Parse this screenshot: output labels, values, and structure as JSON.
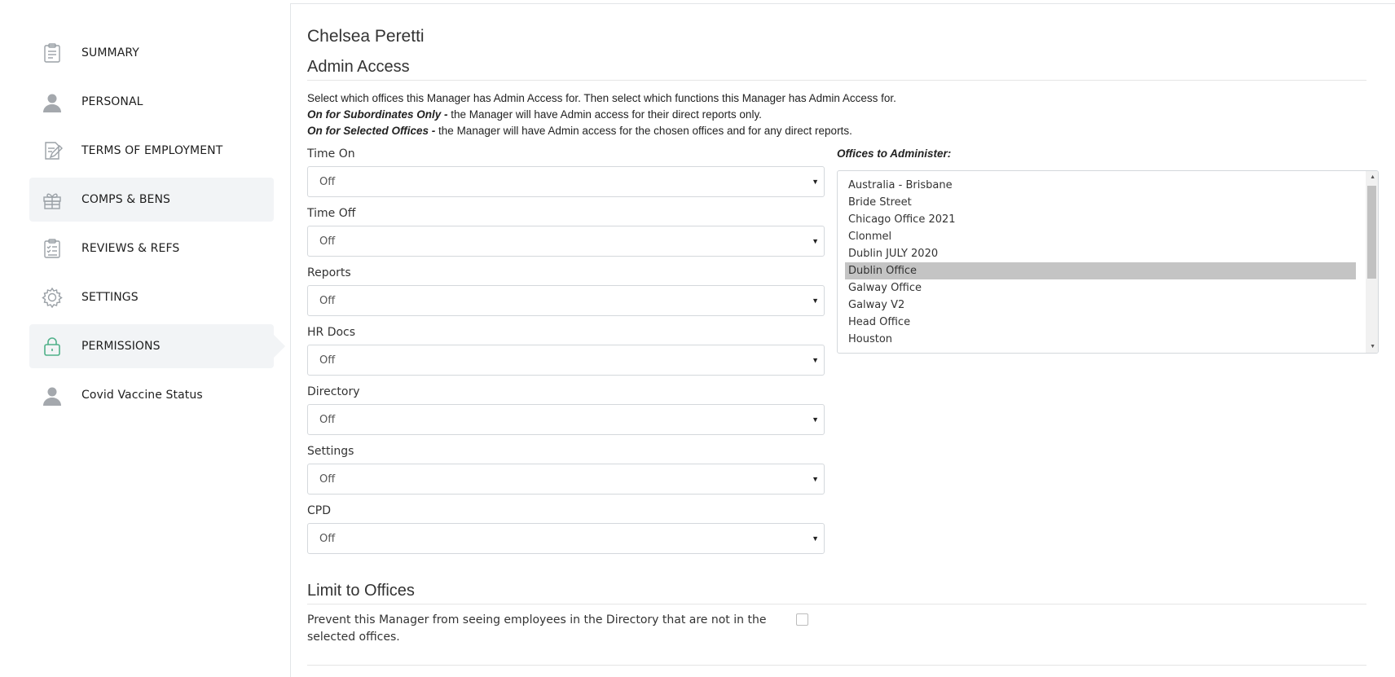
{
  "sidebar": {
    "items": [
      {
        "label": "SUMMARY",
        "icon": "summary-icon"
      },
      {
        "label": "PERSONAL",
        "icon": "person-icon"
      },
      {
        "label": "TERMS OF EMPLOYMENT",
        "icon": "edit-document-icon"
      },
      {
        "label": "COMPS & BENS",
        "icon": "gift-icon"
      },
      {
        "label": "REVIEWS & REFS",
        "icon": "checklist-icon"
      },
      {
        "label": "SETTINGS",
        "icon": "gear-icon"
      },
      {
        "label": "PERMISSIONS",
        "icon": "lock-icon"
      },
      {
        "label": "Covid Vaccine Status",
        "icon": "person-icon"
      }
    ]
  },
  "main": {
    "person_name": "Chelsea Peretti",
    "admin_access": {
      "title": "Admin Access",
      "intro_line1": "Select which offices this Manager has Admin Access for. Then select which functions this Manager has Admin Access for.",
      "intro_line2_bold": "On for Subordinates Only -",
      "intro_line2_rest": " the Manager will have Admin access for their direct reports only.",
      "intro_line3_bold": "On for Selected Offices -",
      "intro_line3_rest": " the Manager will have Admin access for the chosen offices and for any direct reports."
    },
    "functions": [
      {
        "label": "Time On",
        "value": "Off"
      },
      {
        "label": "Time Off",
        "value": "Off"
      },
      {
        "label": "Reports",
        "value": "Off"
      },
      {
        "label": "HR Docs",
        "value": "Off"
      },
      {
        "label": "Directory",
        "value": "Off"
      },
      {
        "label": "Settings",
        "value": "Off"
      },
      {
        "label": "CPD",
        "value": "Off"
      }
    ],
    "offices": {
      "label": "Offices to Administer:",
      "items": [
        "Australia - Brisbane",
        "Bride Street",
        "Chicago Office 2021",
        "Clonmel",
        "Dublin JULY 2020",
        "Dublin Office",
        "Galway Office",
        "Galway V2",
        "Head Office",
        "Houston"
      ],
      "selected": "Dublin Office"
    },
    "limit": {
      "title": "Limit to Offices",
      "text": "Prevent this Manager from seeing employees in the Directory that are not in the selected offices."
    }
  },
  "colors": {
    "active_bg": "#f2f4f6",
    "selected_option": "#c4c4c4",
    "lock_icon": "#4fb089"
  }
}
